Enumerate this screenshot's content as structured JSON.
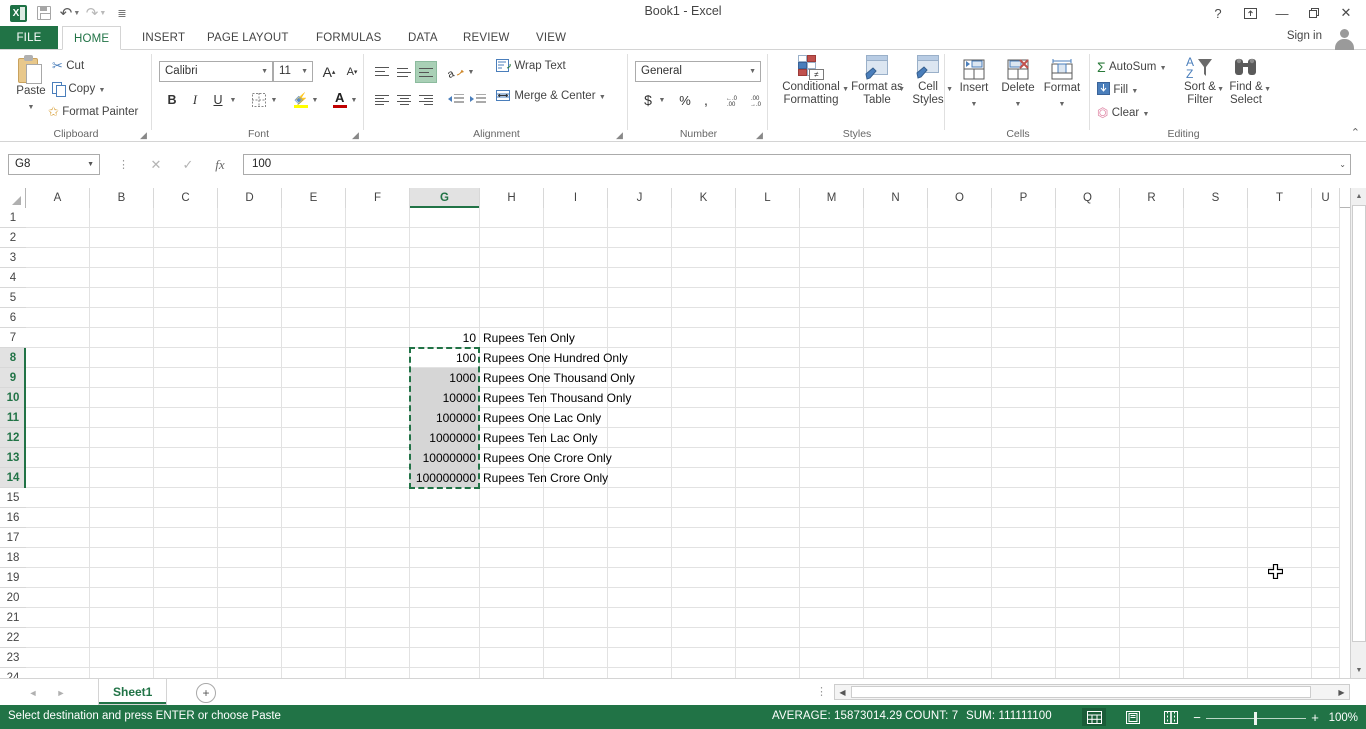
{
  "window": {
    "title": "Book1 - Excel",
    "quick_access": [
      {
        "name": "excel-logo",
        "label": "X"
      },
      {
        "name": "save-icon",
        "label": "Save"
      },
      {
        "name": "undo-icon",
        "label": "Undo"
      },
      {
        "name": "redo-icon",
        "label": "Redo"
      },
      {
        "name": "customize-qat-icon",
        "label": "Customize Quick Access Toolbar"
      }
    ],
    "controls": {
      "help": "?",
      "ribbon_display": "⌧",
      "minimize": "—",
      "restore": "❐",
      "close": "✕"
    },
    "sign_in": "Sign in"
  },
  "ribbon": {
    "tabs": [
      {
        "label": "FILE",
        "active": false,
        "file": true
      },
      {
        "label": "HOME",
        "active": true
      },
      {
        "label": "INSERT",
        "active": false
      },
      {
        "label": "PAGE LAYOUT",
        "active": false
      },
      {
        "label": "FORMULAS",
        "active": false
      },
      {
        "label": "DATA",
        "active": false
      },
      {
        "label": "REVIEW",
        "active": false
      },
      {
        "label": "VIEW",
        "active": false
      }
    ],
    "collapse_arrow": "⌃",
    "groups": {
      "clipboard": {
        "label": "Clipboard",
        "paste": "Paste",
        "cut": "Cut",
        "copy": "Copy",
        "format_painter": "Format Painter"
      },
      "font": {
        "label": "Font",
        "font_name": "Calibri",
        "font_size": "11",
        "grow_font": "A",
        "shrink_font": "A",
        "bold": "B",
        "italic": "I",
        "underline": "U",
        "borders": "Borders",
        "fill_color": "Fill Color",
        "font_color": "A"
      },
      "alignment": {
        "label": "Alignment",
        "wrap_text": "Wrap Text",
        "merge_center": "Merge & Center",
        "orientation": "Orientation",
        "decrease_indent": "Decrease Indent",
        "increase_indent": "Increase Indent"
      },
      "number": {
        "label": "Number",
        "format": "General",
        "accounting": "$",
        "percent": "%",
        "comma": ",",
        "increase_decimal": "←.0",
        "decrease_decimal": ".00"
      },
      "styles": {
        "label": "Styles",
        "conditional_formatting": "Conditional\nFormatting",
        "conditional_formatting_l1": "Conditional",
        "conditional_formatting_l2": "Formatting",
        "format_as_table_l1": "Format as",
        "format_as_table_l2": "Table",
        "cell_styles_l1": "Cell",
        "cell_styles_l2": "Styles"
      },
      "cells": {
        "label": "Cells",
        "insert": "Insert",
        "delete": "Delete",
        "format": "Format"
      },
      "editing": {
        "label": "Editing",
        "autosum": "AutoSum",
        "fill": "Fill",
        "clear": "Clear",
        "sort_filter_l1": "Sort &",
        "sort_filter_l2": "Filter",
        "find_select_l1": "Find &",
        "find_select_l2": "Select"
      }
    }
  },
  "formula_bar": {
    "name_box": "G8",
    "cancel": "✕",
    "enter": "✓",
    "insert_function": "fx",
    "value": "100",
    "expand": "⌄"
  },
  "grid": {
    "columns": [
      "A",
      "B",
      "C",
      "D",
      "E",
      "F",
      "G",
      "H",
      "I",
      "J",
      "K",
      "L",
      "M",
      "N",
      "O",
      "P",
      "Q",
      "R",
      "S",
      "T",
      "U"
    ],
    "selected_column": "G",
    "rows": [
      "1",
      "2",
      "3",
      "4",
      "5",
      "6",
      "7",
      "8",
      "9",
      "10",
      "11",
      "12",
      "13",
      "14",
      "15",
      "16",
      "17",
      "18",
      "19",
      "20",
      "21",
      "22",
      "23",
      "24"
    ],
    "selected_rows": [
      "8",
      "9",
      "10",
      "11",
      "12",
      "13",
      "14"
    ],
    "active_cell": "G8",
    "selection_range": "G8:G14",
    "data": [
      {
        "row": "7",
        "num": "10",
        "text": "Rupees Ten Only",
        "selected": false
      },
      {
        "row": "8",
        "num": "100",
        "text": "Rupees One Hundred  Only",
        "selected": true,
        "active": true
      },
      {
        "row": "9",
        "num": "1000",
        "text": "Rupees One Thousand  Only",
        "selected": true
      },
      {
        "row": "10",
        "num": "10000",
        "text": "Rupees Ten Thousand  Only",
        "selected": true
      },
      {
        "row": "11",
        "num": "100000",
        "text": "Rupees One Lac  Only",
        "selected": true
      },
      {
        "row": "12",
        "num": "1000000",
        "text": "Rupees Ten Lac  Only",
        "selected": true
      },
      {
        "row": "13",
        "num": "10000000",
        "text": "Rupees One Crore  Only",
        "selected": true
      },
      {
        "row": "14",
        "num": "100000000",
        "text": "Rupees Ten Crore  Only",
        "selected": true
      }
    ]
  },
  "sheet_tabs": {
    "prev": "◄",
    "next": "►",
    "tabs": [
      {
        "label": "Sheet1",
        "active": true
      }
    ],
    "add_sheet": "+"
  },
  "status_bar": {
    "message": "Select destination and press ENTER or choose Paste",
    "average": "AVERAGE: 15873014.29",
    "count": "COUNT: 7",
    "sum": "SUM: 111111100",
    "views": [
      {
        "name": "normal-view",
        "active": true
      },
      {
        "name": "page-layout-view",
        "active": false
      },
      {
        "name": "page-break-preview",
        "active": false
      }
    ],
    "zoom_out": "−",
    "zoom_in": "+",
    "zoom": "100%"
  },
  "colors": {
    "accent_green": "#217346",
    "selection_gray": "#d6d6d6",
    "ribbon_border": "#d4d4d4"
  }
}
